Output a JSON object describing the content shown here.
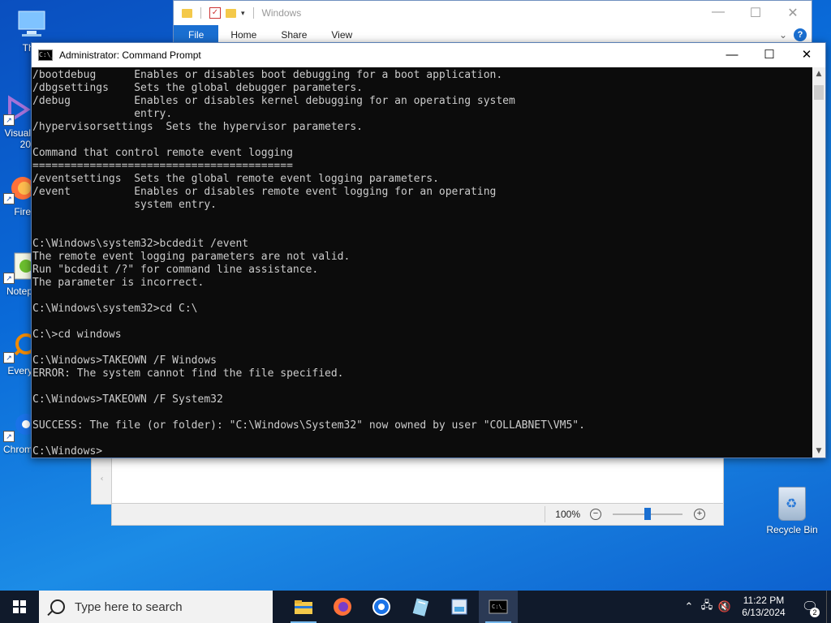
{
  "desktop": {
    "icons": [
      {
        "label": "This",
        "icon": "this-pc-icon"
      },
      {
        "label": "Visual\n20",
        "icon": "visual-studio-icon"
      },
      {
        "label": "Fire",
        "icon": "firefox-icon"
      },
      {
        "label": "Notep",
        "icon": "notepad-plus-plus-icon"
      },
      {
        "label": "Every",
        "icon": "everything-icon"
      },
      {
        "label": "Chrom",
        "icon": "chrome-icon"
      }
    ],
    "recycle_bin": "Recycle Bin"
  },
  "explorer": {
    "title": "Windows",
    "tabs": [
      "File",
      "Home",
      "Share",
      "View"
    ],
    "controls": {
      "minimize": "—",
      "maximize": "☐",
      "close": "✕"
    },
    "help": "?",
    "expand": "⌄"
  },
  "notepad": {
    "zoom": "100%",
    "zoom_out": "−",
    "zoom_in": "+",
    "zoom_level": 0.5,
    "scroll_left": "‹"
  },
  "cmd": {
    "title": "Administrator: Command Prompt",
    "icon_glyph": "C:\\_",
    "controls": {
      "minimize": "—",
      "maximize": "☐",
      "close": "✕"
    },
    "lines": [
      "/bootdebug      Enables or disables boot debugging for a boot application.",
      "/dbgsettings    Sets the global debugger parameters.",
      "/debug          Enables or disables kernel debugging for an operating system",
      "                entry.",
      "/hypervisorsettings  Sets the hypervisor parameters.",
      "",
      "Command that control remote event logging",
      "=========================================",
      "/eventsettings  Sets the global remote event logging parameters.",
      "/event          Enables or disables remote event logging for an operating",
      "                system entry.",
      "",
      "",
      "C:\\Windows\\system32>bcdedit /event",
      "The remote event logging parameters are not valid.",
      "Run \"bcdedit /?\" for command line assistance.",
      "The parameter is incorrect.",
      "",
      "C:\\Windows\\system32>cd C:\\",
      "",
      "C:\\>cd windows",
      "",
      "C:\\Windows>TAKEOWN /F Windows",
      "ERROR: The system cannot find the file specified.",
      "",
      "C:\\Windows>TAKEOWN /F System32",
      "",
      "SUCCESS: The file (or folder): \"C:\\Windows\\System32\" now owned by user \"COLLABNET\\VM5\".",
      "",
      "C:\\Windows>"
    ],
    "scroll_up": "▲",
    "scroll_down": "▼"
  },
  "taskbar": {
    "search_placeholder": "Type here to search",
    "apps": [
      {
        "name": "file-explorer",
        "icon": "folder-icon",
        "state": "open"
      },
      {
        "name": "firefox",
        "icon": "firefox-icon",
        "state": ""
      },
      {
        "name": "chrome",
        "icon": "chrome-icon",
        "state": ""
      },
      {
        "name": "notepad",
        "icon": "notepad-icon",
        "state": ""
      },
      {
        "name": "image-viewer",
        "icon": "image-icon",
        "state": ""
      },
      {
        "name": "command-prompt",
        "icon": "cmd-icon",
        "state": "active"
      }
    ],
    "tray": {
      "chevron": "⌃",
      "network": "🖧",
      "volume": "🔇",
      "time": "11:22 PM",
      "date": "6/13/2024",
      "notifications": "🗨",
      "notification_count": "2"
    }
  }
}
